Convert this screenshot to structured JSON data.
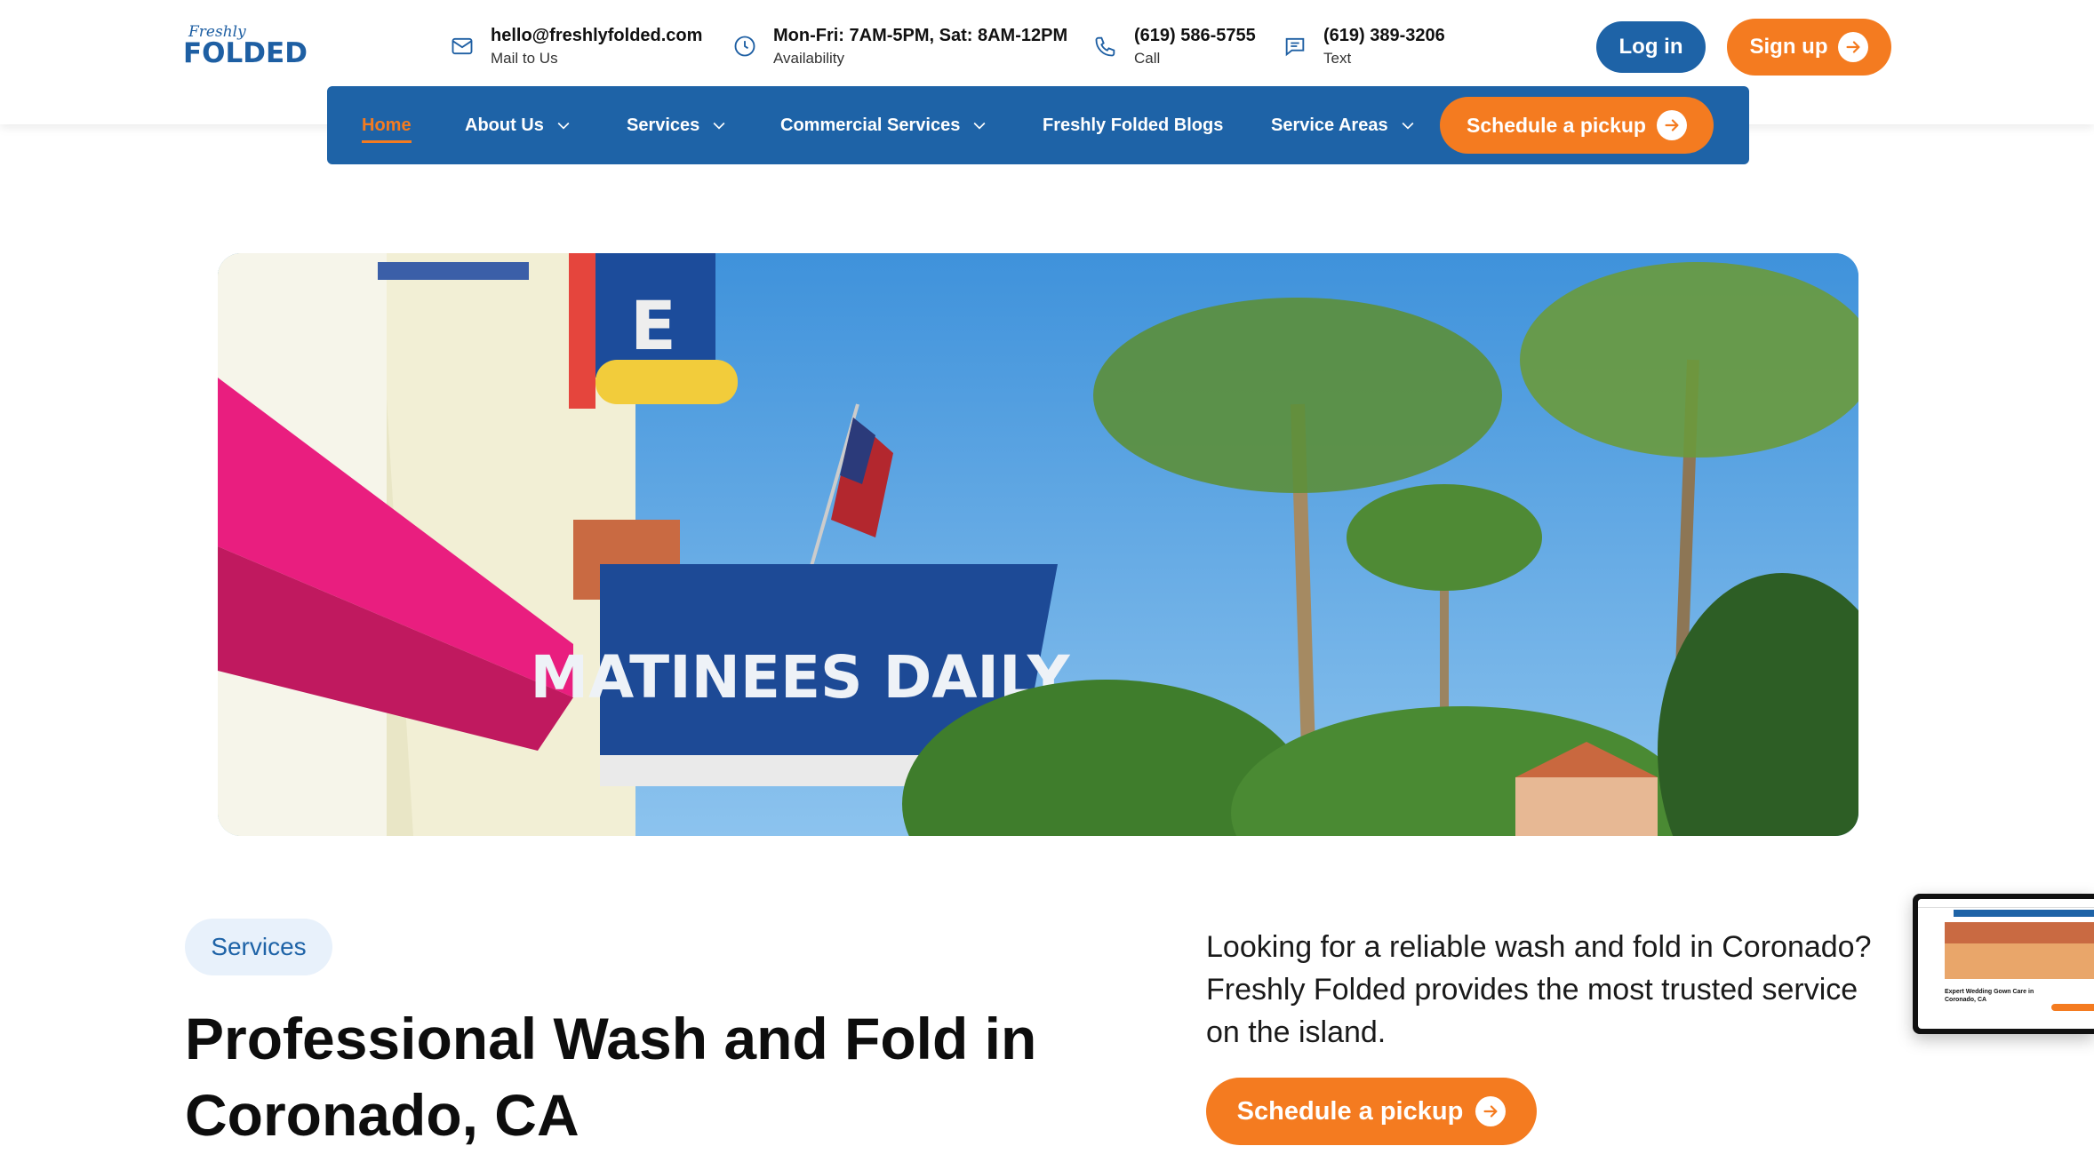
{
  "brand": {
    "logo_script": "Freshly",
    "logo_word": "FOLDED"
  },
  "contacts": [
    {
      "icon": "mail-icon",
      "main": "hello@freshlyfolded.com",
      "sub": "Mail to Us"
    },
    {
      "icon": "clock-icon",
      "main": "Mon-Fri: 7AM-5PM, Sat: 8AM-12PM",
      "sub": "Availability"
    },
    {
      "icon": "phone-icon",
      "main": "(619) 586-5755",
      "sub": "Call"
    },
    {
      "icon": "message-icon",
      "main": "(619) 389-3206",
      "sub": "Text"
    }
  ],
  "auth": {
    "login": "Log in",
    "signup": "Sign up"
  },
  "nav": {
    "items": [
      {
        "label": "Home",
        "active": true
      },
      {
        "label": "About Us",
        "dropdown": true
      },
      {
        "label": "Services",
        "dropdown": true
      },
      {
        "label": "Commercial Services",
        "dropdown": true
      },
      {
        "label": "Freshly Folded Blogs"
      },
      {
        "label": "Service Areas",
        "dropdown": true
      }
    ],
    "cta": "Schedule a pickup"
  },
  "hero": {
    "marquee_text": "MATINEES DAILY",
    "sign_letter": "E"
  },
  "content": {
    "tag": "Services",
    "headline_line1": "Professional Wash and Fold in",
    "headline_line2": "Coronado, CA",
    "lead": "Looking for a reliable wash and fold in Coronado? Freshly Folded provides the most trusted service on the island.",
    "cta": "Schedule a pickup"
  },
  "thumbnail": {
    "caption": "Expert Wedding Gown Care in Coronado, CA"
  },
  "colors": {
    "brand_blue": "#1e63a7",
    "accent_orange": "#f47b20",
    "pill_bg": "#e8f1fb"
  }
}
